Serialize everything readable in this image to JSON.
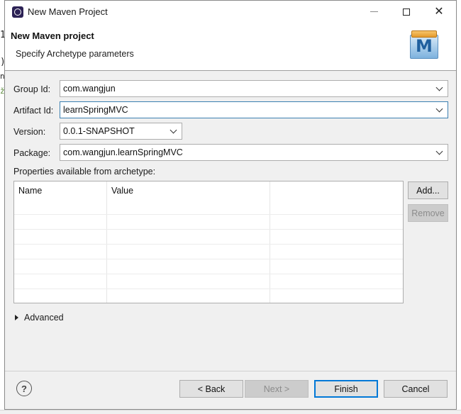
{
  "window": {
    "title": "New Maven Project",
    "min_icon": "minimize-icon",
    "max_icon": "maximize-icon",
    "close_icon": "close-icon",
    "close_glyph": "✕"
  },
  "background_editor": {
    "fragments": [
      "1",
      ")",
      "n",
      "ž"
    ]
  },
  "header": {
    "title": "New Maven project",
    "subtitle": "Specify Archetype parameters",
    "logo_letter": "M"
  },
  "form": {
    "group_id": {
      "label": "Group Id:",
      "value": "com.wangjun"
    },
    "artifact_id": {
      "label": "Artifact Id:",
      "value": "learnSpringMVC"
    },
    "version": {
      "label": "Version:",
      "value": "0.0.1-SNAPSHOT"
    },
    "package": {
      "label": "Package:",
      "value": "com.wangjun.learnSpringMVC"
    }
  },
  "properties": {
    "label": "Properties available from archetype:",
    "columns": [
      "Name",
      "Value",
      ""
    ],
    "rows": [],
    "add_button": "Add...",
    "remove_button": "Remove"
  },
  "advanced": {
    "label": "Advanced"
  },
  "footer": {
    "help_glyph": "?",
    "back": "< Back",
    "next": "Next >",
    "finish": "Finish",
    "cancel": "Cancel"
  },
  "colors": {
    "dialog_bg": "#f0f0f0",
    "focus_border": "#3c7fb1",
    "default_button_border": "#0078d7"
  }
}
